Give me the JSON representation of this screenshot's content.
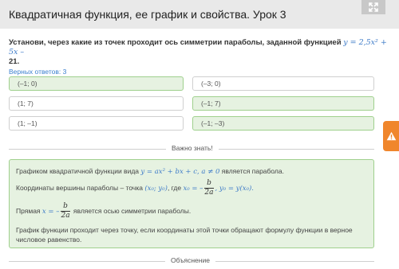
{
  "header": {
    "title": "Квадратичная функция, ее график и свойства. Урок 3",
    "expand_icon": "expand-arrows-icon"
  },
  "question": {
    "text_before": "Установи, через какие из точек проходит ось симметрии параболы, заданной функцией ",
    "formula": "y = 2,5x² + 5x –",
    "text_after": "21."
  },
  "answers_count": "Верных ответов: 3",
  "options": [
    {
      "label": "(–1; 0)",
      "selected": true
    },
    {
      "label": "(–3; 0)",
      "selected": false
    },
    {
      "label": "(1; 7)",
      "selected": false
    },
    {
      "label": "(–1; 7)",
      "selected": true
    },
    {
      "label": "(1; –1)",
      "selected": false
    },
    {
      "label": "(–1; –3)",
      "selected": true
    }
  ],
  "important": {
    "label": "Важно знать!",
    "line1_before": "Графиком квадратичной функции вида ",
    "line1_formula": "y = ax² + bx + c, a ≠ 0",
    "line1_after": " является парабола.",
    "line2_before": "Координаты вершины параболы – точка ",
    "line2_point": "(x₀; y₀)",
    "line2_mid": ", где ",
    "line2_x0": "x₀ = –",
    "frac_num": "b",
    "frac_den": "2a",
    "line2_y0": ", y₀ = y(x₀).",
    "line3_before": "Прямая ",
    "line3_x": "x = –",
    "line3_after": " является осью симметрии параболы.",
    "line4": "График функции проходит через точку, если координаты этой точки обращают формулу функции в верное",
    "line5": "числовое равенство."
  },
  "explanation": {
    "label": "Объяснение"
  },
  "colors": {
    "selected_bg": "#e6f2e1",
    "selected_border": "#9fd08d",
    "accent_blue": "#3a7fcf",
    "warning_orange": "#f0862c"
  },
  "warning_icon": "warning-triangle-icon"
}
